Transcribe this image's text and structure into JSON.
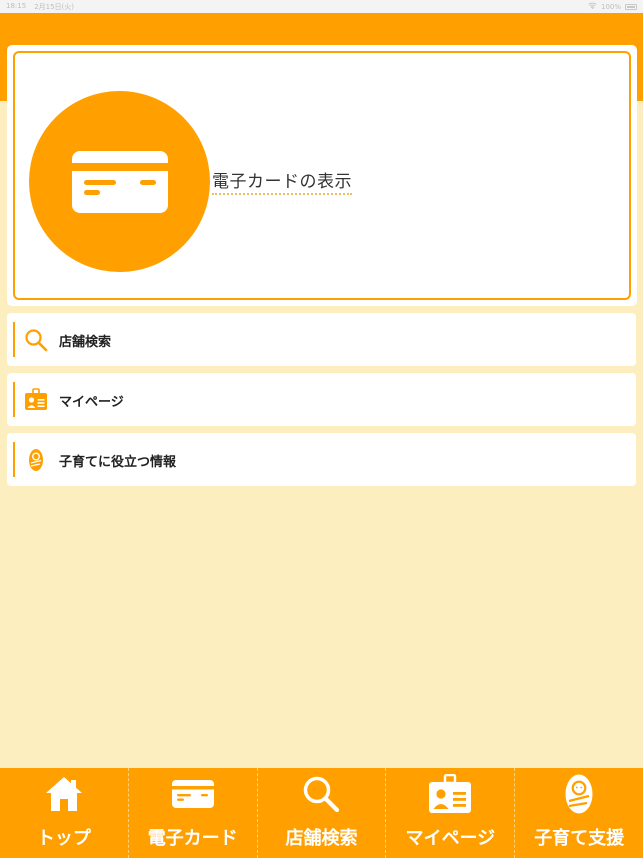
{
  "status_bar": {
    "time": "18:15",
    "date": "2月15日(火)",
    "battery": "100%"
  },
  "colors": {
    "accent": "#ffa000",
    "background": "#fdeec0",
    "card": "#ffffff"
  },
  "hero": {
    "icon": "credit-card-icon",
    "label": "電子カードの表示"
  },
  "menu": [
    {
      "icon": "search-icon",
      "label": "店舗検索"
    },
    {
      "icon": "id-card-icon",
      "label": "マイページ"
    },
    {
      "icon": "baby-icon",
      "label": "子育てに役立つ情報"
    }
  ],
  "tabs": [
    {
      "icon": "home-icon",
      "label": "トップ"
    },
    {
      "icon": "credit-card-icon",
      "label": "電子カード"
    },
    {
      "icon": "search-icon",
      "label": "店舗検索"
    },
    {
      "icon": "id-card-icon",
      "label": "マイページ"
    },
    {
      "icon": "baby-icon",
      "label": "子育て支援"
    }
  ]
}
